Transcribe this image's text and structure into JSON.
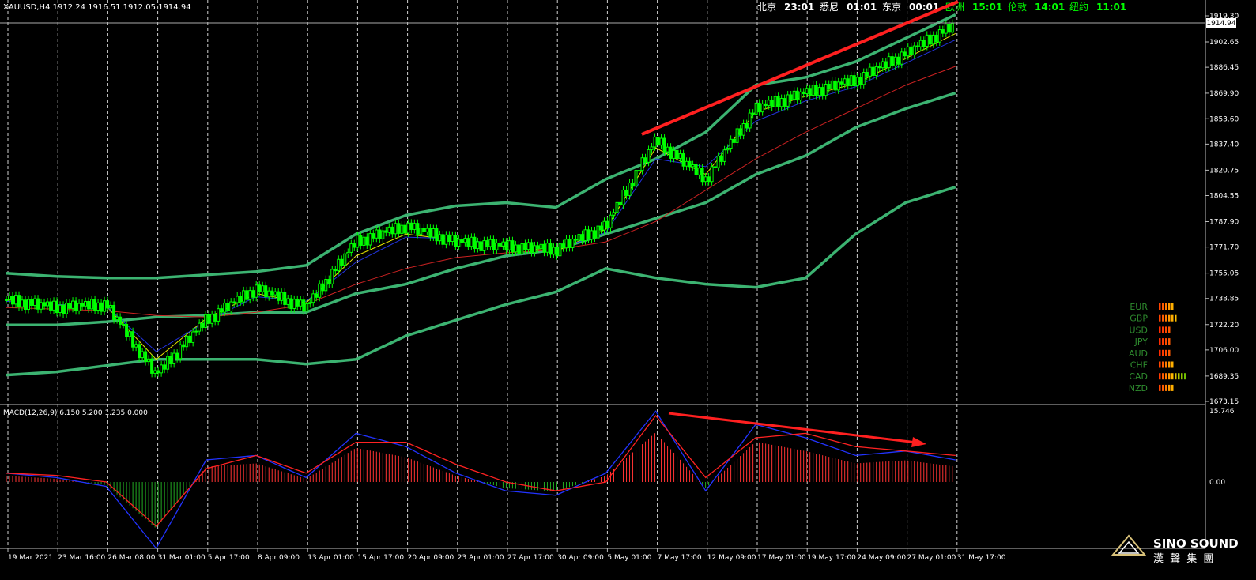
{
  "header": {
    "symbol_line": "XAUUSD,H4  1912.24 1916.51 1912.05 1914.94"
  },
  "clocks": [
    {
      "city": "北京",
      "time": "23:01",
      "city_color": "#ffffff",
      "time_color": "#ffffff"
    },
    {
      "city": "悉尼",
      "time": "01:01",
      "city_color": "#ffffff",
      "time_color": "#ffffff"
    },
    {
      "city": "东京",
      "time": "00:01",
      "city_color": "#ffffff",
      "time_color": "#ffffff"
    },
    {
      "city": "欧洲",
      "time": "15:01",
      "city_color": "#00ff00",
      "time_color": "#00ff00"
    },
    {
      "city": "伦敦",
      "time": "14:01",
      "city_color": "#00ff00",
      "time_color": "#00ff00"
    },
    {
      "city": "纽约",
      "time": "11:01",
      "city_color": "#00ff00",
      "time_color": "#00ff00"
    }
  ],
  "price_axis": {
    "ticks": [
      "1919.30",
      "1902.65",
      "1886.45",
      "1869.90",
      "1853.60",
      "1837.40",
      "1820.75",
      "1804.55",
      "1787.90",
      "1771.70",
      "1755.05",
      "1738.85",
      "1722.20",
      "1706.00",
      "1689.35",
      "1673.15"
    ],
    "current_price": "1914.94"
  },
  "time_axis": {
    "labels": [
      "19 Mar 2021",
      "23 Mar 16:00",
      "26 Mar 08:00",
      "31 Mar 01:00",
      "5 Apr 17:00",
      "8 Apr 09:00",
      "13 Apr 01:00",
      "15 Apr 17:00",
      "20 Apr 09:00",
      "23 Apr 01:00",
      "27 Apr 17:00",
      "30 Apr 09:00",
      "5 May 01:00",
      "7 May 17:00",
      "12 May 09:00",
      "17 May 01:00",
      "19 May 17:00",
      "24 May 09:00",
      "27 May 01:00",
      "31 May 17:00"
    ]
  },
  "macd_panel": {
    "label": "MACD(12,26,9) 6.150 5.200 1.235 0.000",
    "ticks": [
      "15.746",
      "0.00"
    ]
  },
  "currency_strength": [
    {
      "code": "EUR",
      "bars": 5,
      "scheme": "orange"
    },
    {
      "code": "GBP",
      "bars": 6,
      "scheme": "orange"
    },
    {
      "code": "USD",
      "bars": 4,
      "scheme": "red"
    },
    {
      "code": "JPY",
      "bars": 4,
      "scheme": "red"
    },
    {
      "code": "AUD",
      "bars": 4,
      "scheme": "red"
    },
    {
      "code": "CHF",
      "bars": 5,
      "scheme": "orange"
    },
    {
      "code": "CAD",
      "bars": 9,
      "scheme": "mixed"
    },
    {
      "code": "NZD",
      "bars": 5,
      "scheme": "orange"
    }
  ],
  "logo": {
    "text_en": "SINO SOUND",
    "text_cn": "漢 聲 集 團"
  },
  "chart_data": {
    "type": "line",
    "ylim": [
      1673.15,
      1919.3
    ],
    "categories": [
      "19 Mar 2021",
      "23 Mar 16:00",
      "26 Mar 08:00",
      "31 Mar 01:00",
      "5 Apr 17:00",
      "8 Apr 09:00",
      "13 Apr 01:00",
      "15 Apr 17:00",
      "20 Apr 09:00",
      "23 Apr 01:00",
      "27 Apr 17:00",
      "30 Apr 09:00",
      "5 May 01:00",
      "7 May 17:00",
      "12 May 09:00",
      "17 May 01:00",
      "19 May 17:00",
      "24 May 09:00",
      "27 May 01:00",
      "31 May 17:00"
    ],
    "series": [
      {
        "role": "price",
        "color": "#00ff00",
        "values": [
          1738,
          1733,
          1735,
          1690,
          1725,
          1745,
          1733,
          1775,
          1785,
          1775,
          1772,
          1770,
          1785,
          1840,
          1815,
          1860,
          1870,
          1878,
          1895,
          1914
        ]
      },
      {
        "role": "bb-outer-upper",
        "color": "#3cb371",
        "values": [
          1755,
          1753,
          1752,
          1752,
          1754,
          1756,
          1760,
          1780,
          1792,
          1798,
          1800,
          1797,
          1815,
          1828,
          1845,
          1875,
          1880,
          1890,
          1905,
          1920
        ]
      },
      {
        "role": "bb-outer-mid",
        "color": "#3cb371",
        "values": [
          1722,
          1722,
          1724,
          1727,
          1728,
          1730,
          1730,
          1742,
          1748,
          1758,
          1766,
          1770,
          1780,
          1790,
          1800,
          1818,
          1830,
          1848,
          1860,
          1870
        ]
      },
      {
        "role": "bb-outer-lower",
        "color": "#3cb371",
        "values": [
          1690,
          1692,
          1696,
          1700,
          1700,
          1700,
          1697,
          1700,
          1715,
          1725,
          1735,
          1743,
          1758,
          1752,
          1748,
          1746,
          1752,
          1780,
          1800,
          1810
        ]
      },
      {
        "role": "ma-red",
        "color": "#cc2222",
        "values": [
          1733,
          1732,
          1731,
          1728,
          1727,
          1730,
          1735,
          1748,
          1758,
          1765,
          1768,
          1770,
          1775,
          1788,
          1808,
          1828,
          1845,
          1860,
          1875,
          1887
        ]
      },
      {
        "role": "ma-yellow",
        "color": "#e6e600",
        "values": [
          1738,
          1735,
          1734,
          1700,
          1726,
          1742,
          1736,
          1766,
          1780,
          1776,
          1772,
          1769,
          1783,
          1835,
          1818,
          1858,
          1868,
          1876,
          1892,
          1908
        ]
      },
      {
        "role": "ma-blue",
        "color": "#2233dd",
        "values": [
          1737,
          1735,
          1734,
          1705,
          1724,
          1740,
          1737,
          1762,
          1778,
          1777,
          1773,
          1770,
          1781,
          1828,
          1823,
          1852,
          1865,
          1874,
          1889,
          1904
        ]
      },
      {
        "role": "macd-main",
        "color": "#2233ff",
        "values": [
          2,
          1,
          -1,
          -15,
          5,
          6,
          1,
          11,
          8,
          2,
          -2,
          -3,
          2,
          16,
          -2,
          13,
          10,
          6,
          7,
          5
        ]
      },
      {
        "role": "macd-signal",
        "color": "#ff2222",
        "values": [
          2,
          1.5,
          0,
          -10,
          3,
          6,
          2,
          9,
          9,
          4,
          0,
          -2,
          0,
          15,
          1,
          10,
          11,
          8,
          7,
          6
        ]
      }
    ]
  }
}
